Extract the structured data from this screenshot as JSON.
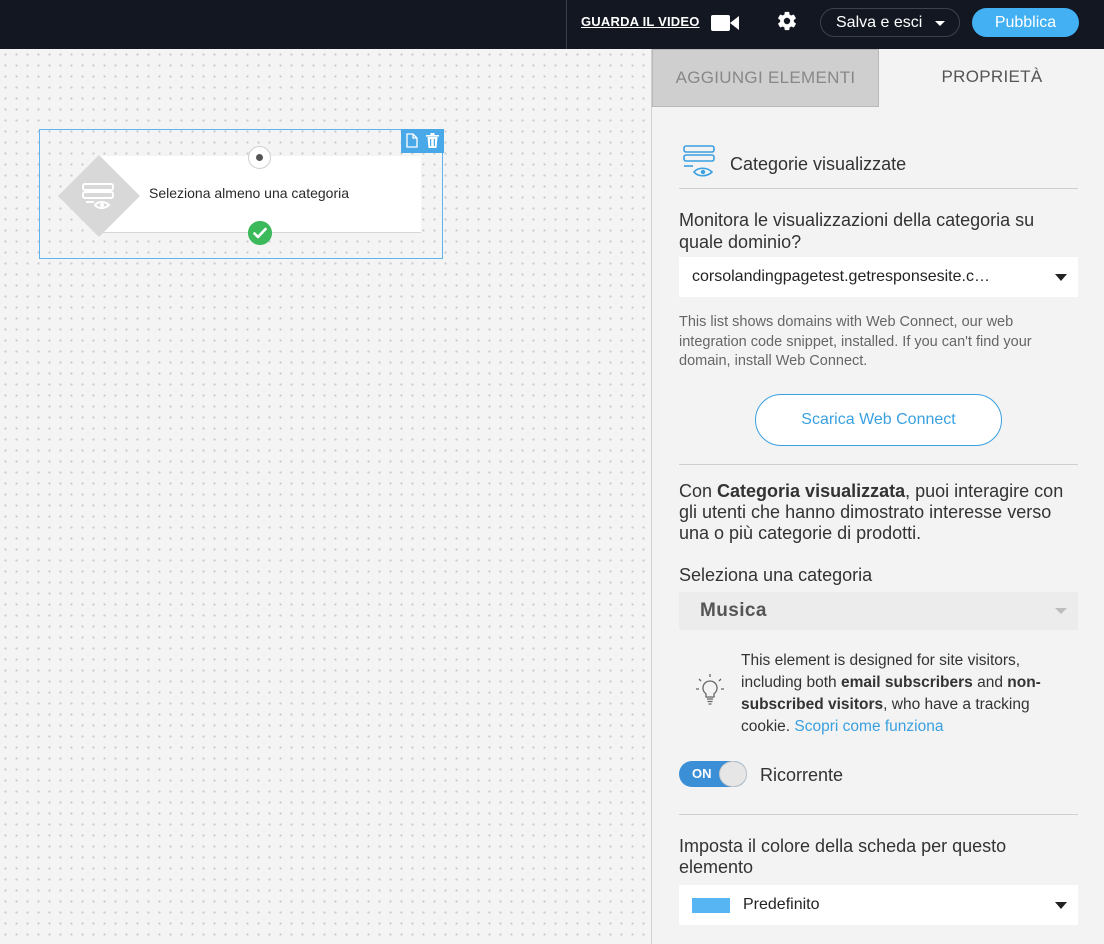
{
  "header": {
    "video_link": "GUARDA IL VIDEO",
    "save_label": "Salva e esci",
    "publish_label": "Pubblica",
    "accent_color": "#42b0f3"
  },
  "canvas": {
    "node": {
      "label": "Seleziona almeno una categoria",
      "icon": "category-view-icon",
      "status": "check-icon"
    }
  },
  "panel": {
    "tabs": [
      {
        "label": "AGGIUNGI ELEMENTI",
        "active": false
      },
      {
        "label": "PROPRIETÀ",
        "active": true
      }
    ],
    "section_title": "Categorie visualizzate",
    "domain_question": "Monitora le visualizzazioni della categoria su quale dominio?",
    "domain_value": "corsolandingpagetest.getresponsesite.c…",
    "domain_help": "This list shows domains with Web Connect, our web integration code snippet, installed. If you can't find your domain, install Web Connect.",
    "download_button": "Scarica Web Connect",
    "description": {
      "prefix": "Con ",
      "bold": "Categoria visualizzata",
      "suffix": ", puoi interagire con gli utenti che hanno dimostrato interesse verso una o più categorie di prodotti."
    },
    "category_label": "Seleziona una categoria",
    "category_value": "Musica",
    "info": {
      "part1": "This element is designed for site visitors, including both ",
      "bold1": "email subscribers",
      "part2": " and ",
      "bold2": "non-subscribed visitors",
      "part3": ", who have a tracking cookie. ",
      "link": "Scopri come funziona"
    },
    "toggle": {
      "state_label": "ON",
      "label": "Ricorrente",
      "on": true
    },
    "color_label": "Imposta il colore della scheda per questo elemento",
    "color_value": "Predefinito",
    "color_swatch": "#56b5f2"
  }
}
